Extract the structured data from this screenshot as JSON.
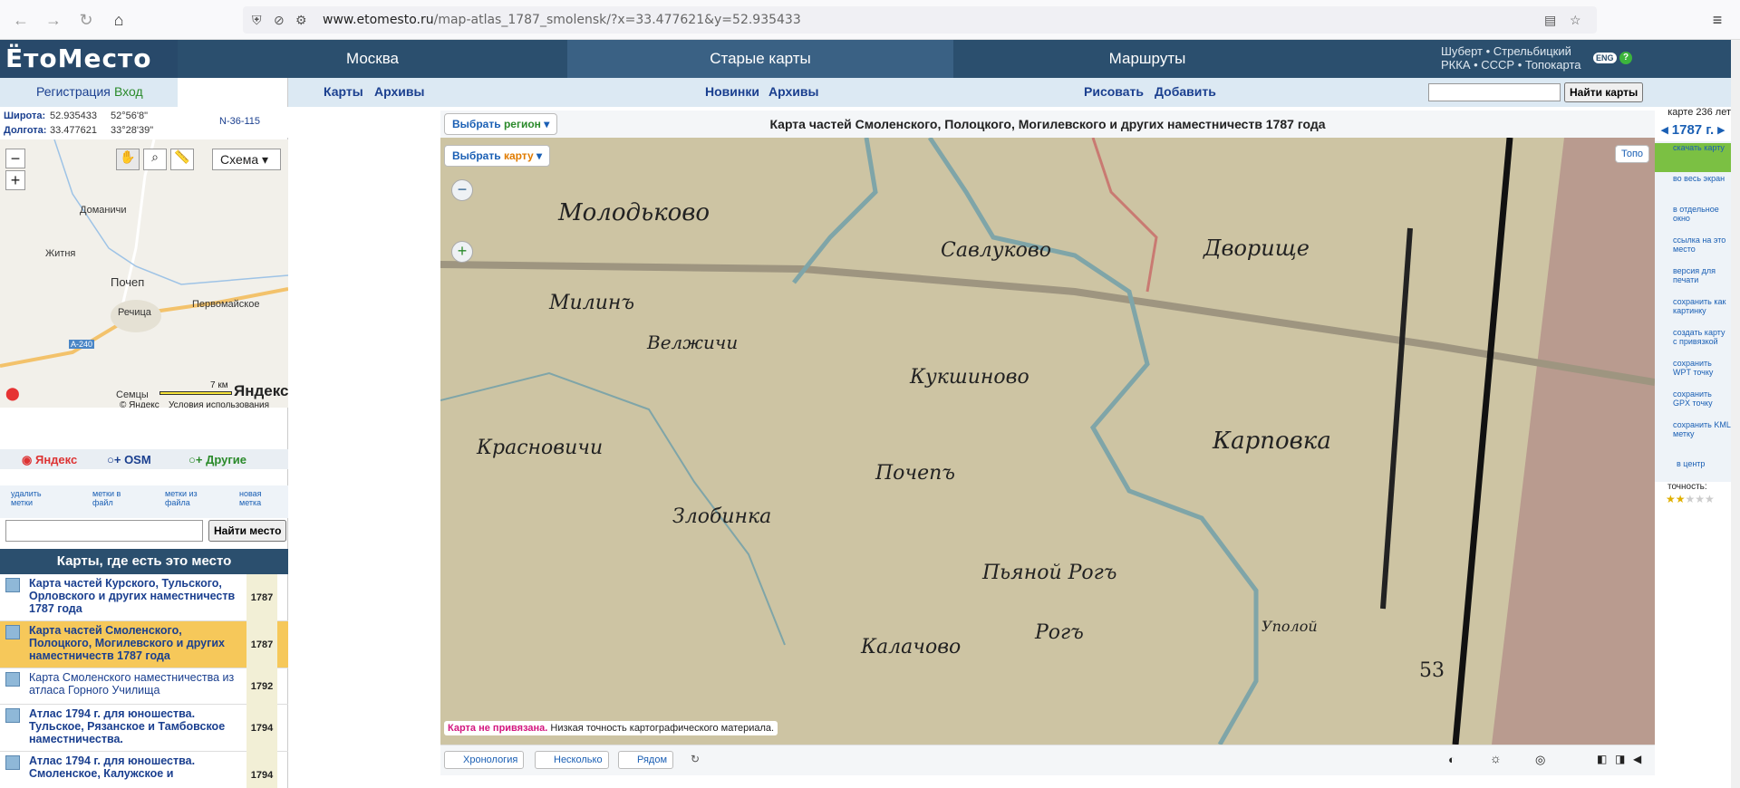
{
  "browser": {
    "url_domain": "www.etomesto.ru",
    "url_path": "/map-atlas_1787_smolensk/?x=33.477621&y=52.935433"
  },
  "site": {
    "logo": "ЁтоМесто",
    "tabs": [
      "Москва",
      "Старые карты",
      "Маршруты"
    ],
    "right_links_1": "Шуберт • Стрельбицкий",
    "right_links_2": "РККА • СССР • Топокарта",
    "lang": "ENG",
    "help": "?",
    "register": "Регистрация",
    "login": "Вход",
    "sub": {
      "moscow": [
        "Карты",
        "Архивы"
      ],
      "old": [
        "Новинки",
        "Архивы"
      ],
      "routes": [
        "Рисовать",
        "Добавить"
      ]
    },
    "find_maps_btn": "Найти карты"
  },
  "coords": {
    "lat_label": "Широта:",
    "lat": "52.935433",
    "lat_dms": "52°56'8\"",
    "lon_label": "Долгота:",
    "lon": "33.477621",
    "lon_dms": "33°28'39\"",
    "sheet": "N-36-115"
  },
  "minimap": {
    "mode": "Схема",
    "towns": [
      "Доманичи",
      "Житня",
      "Почеп",
      "Речица",
      "Первомайское",
      "Семцы"
    ],
    "road": "A-240",
    "scale": "7 км",
    "brand": "Яндекс",
    "copy": "© Яндекс",
    "terms": "Условия использования"
  },
  "sources": [
    "Яндекс",
    "OSM",
    "Другие"
  ],
  "tools": [
    "удалить метки",
    "метки в файл",
    "метки из файла",
    "новая метка"
  ],
  "place_btn": "Найти место",
  "maps_header": "Карты, где есть это место",
  "maps": [
    {
      "title": "Карта частей Курского, Тульского, Орловского и других наместничеств 1787 года",
      "year": "1787"
    },
    {
      "title": "Карта частей Смоленского, Полоцкого, Могилевского и других наместничеств 1787 года",
      "year": "1787",
      "active": true
    },
    {
      "title": "Карта Смоленского наместничества из атласа Горного Училища",
      "year": "1792"
    },
    {
      "title": "Атлас 1794 г. для юношества. Тульское, Рязанское и Тамбовское наместничества.",
      "year": "1794"
    },
    {
      "title": "Атлас 1794 г. для юношества. Смоленское, Калужское и",
      "year": "1794"
    }
  ],
  "map": {
    "region_btn_1": "Выбрать",
    "region_btn_2": "регион",
    "map_btn_1": "Выбрать",
    "map_btn_2": "карту",
    "title": "Карта частей Смоленского, Полоцкого, Могилевского и других наместничеств 1787 года",
    "age": "карте 236 лет",
    "year": "1787 г.",
    "topo": "Топо",
    "notice_red": "Карта не привязана.",
    "notice": "Низкая точность картографического материала.",
    "places": [
      "Молодьково",
      "Милинъ",
      "Велжичи",
      "Савлуково",
      "Дворище",
      "Кукшиново",
      "Красновичи",
      "Почепъ",
      "Карповка",
      "Злобинка",
      "Пьяной Рогъ",
      "Рогъ",
      "Калачово",
      "Уполой",
      "53"
    ]
  },
  "right_tools": [
    "скачать карту",
    "во весь экран",
    "в отдельное окно",
    "ссылка на это место",
    "версия для печати",
    "сохранить как картинку",
    "создать карту с привязкой",
    "сохранить WPT точку",
    "сохранить GPX точку",
    "сохранить KML метку",
    "в центр"
  ],
  "accuracy": "точность:",
  "bottom": [
    "Хронология",
    "Несколько",
    "Рядом"
  ]
}
